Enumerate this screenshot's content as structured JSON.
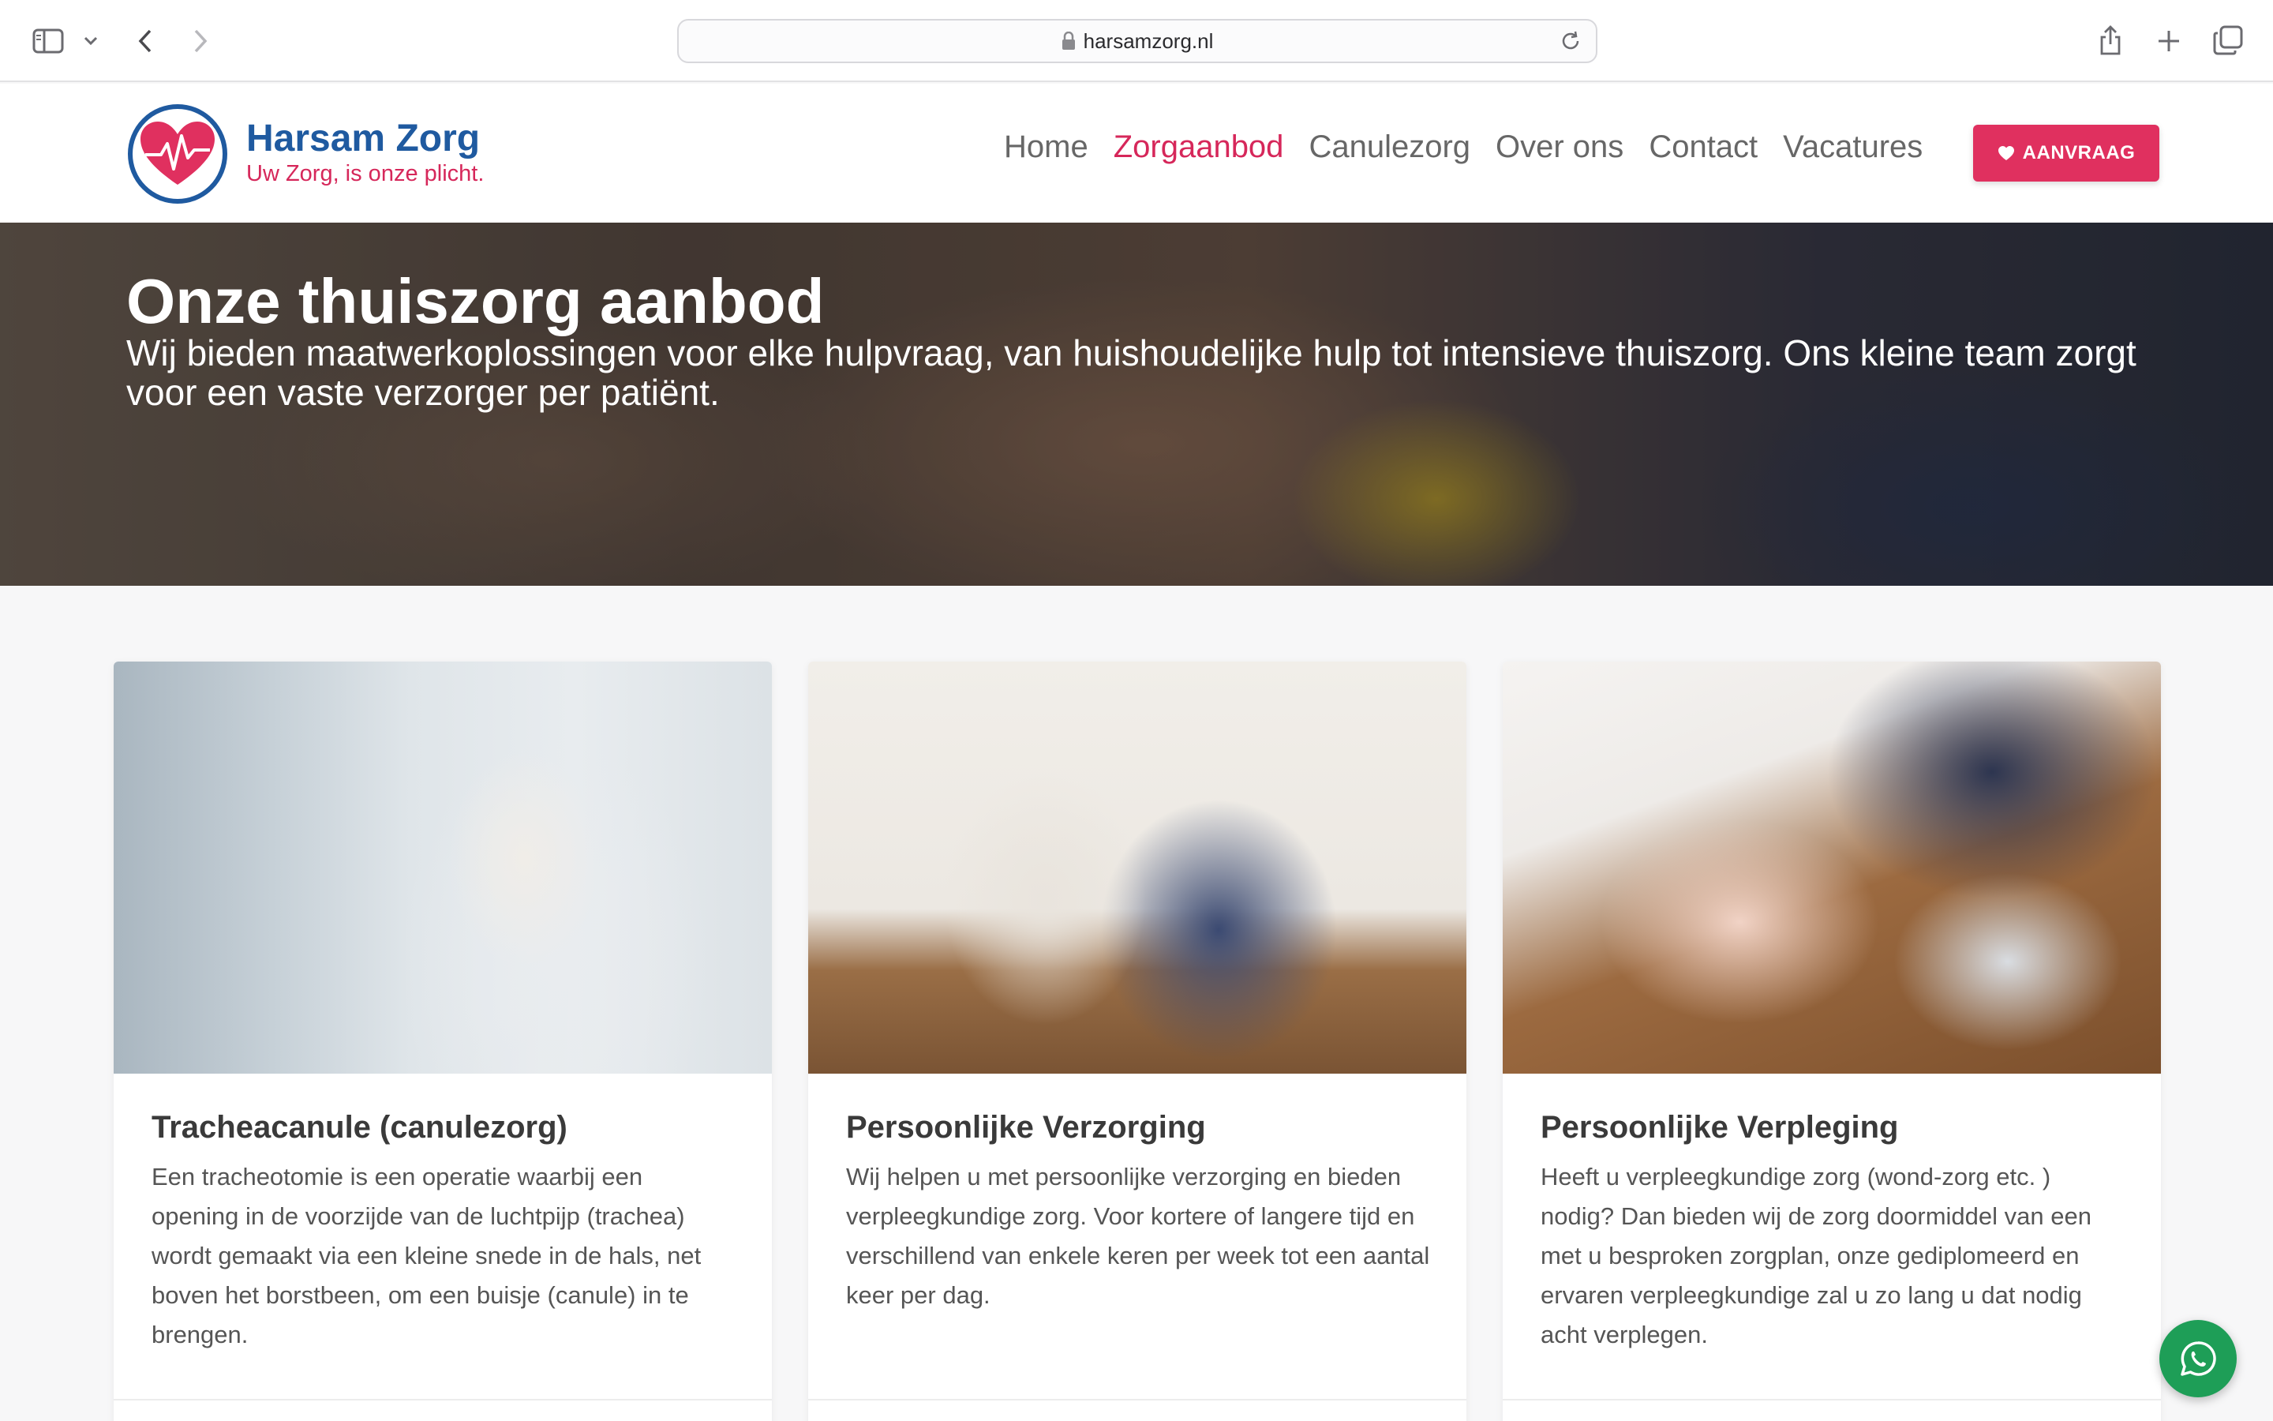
{
  "browser": {
    "url": "harsamzorg.nl"
  },
  "brand": {
    "name": "Harsam Zorg",
    "tagline": "Uw Zorg, is onze plicht.",
    "colors": {
      "primary": "#1f5aa0",
      "accent": "#e0305f"
    }
  },
  "nav": {
    "items": [
      {
        "label": "Home"
      },
      {
        "label": "Zorgaanbod"
      },
      {
        "label": "Canulezorg"
      },
      {
        "label": "Over ons"
      },
      {
        "label": "Contact"
      },
      {
        "label": "Vacatures"
      }
    ],
    "cta_label": "AANVRAAG"
  },
  "hero": {
    "title": "Onze thuiszorg aanbod",
    "subtitle": "Wij bieden maatwerkoplossingen voor elke hulpvraag, van huishoudelijke hulp tot intensieve thuiszorg. Ons kleine team zorgt voor een vaste verzorger per patiënt."
  },
  "cards": [
    {
      "title": "Tracheacanule (canulezorg)",
      "text": "Een tracheotomie is een operatie waarbij een opening in de voorzijde van de luchtpijp (trachea) wordt gemaakt via een kleine snede in de hals, net boven het borstbeen, om een buisje (canule) in te brengen."
    },
    {
      "title": "Persoonlijke Verzorging",
      "text": "Wij helpen u met persoonlijke verzorging en bieden verpleegkundige zorg. Voor kortere of langere tijd en verschillend van enkele keren per week tot een aantal keer per dag."
    },
    {
      "title": "Persoonlijke Verpleging",
      "text": "Heeft u verpleegkundige zorg (wond-zorg etc. ) nodig? Dan bieden wij de zorg doormiddel van een met u besproken zorgplan, onze gediplomeerd en ervaren verpleegkundige zal u zo lang u dat nodig acht verplegen."
    }
  ],
  "icons": {
    "sidebar": "sidebar-icon",
    "back": "chevron-left-icon",
    "forward": "chevron-right-icon",
    "share": "share-icon",
    "new_tab": "plus-icon",
    "tabs": "tabs-icon",
    "whatsapp": "whatsapp-icon"
  }
}
